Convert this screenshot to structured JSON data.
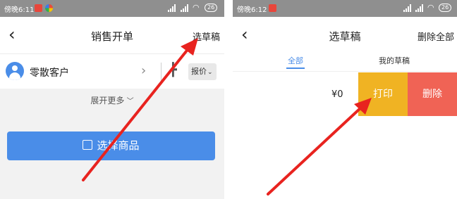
{
  "left": {
    "statusbar": {
      "time": "傍晚6:11",
      "battery": "26"
    },
    "navbar": {
      "title": "销售开单",
      "right": "选草稿"
    },
    "customer": {
      "name": "零散客户",
      "quote": "报价"
    },
    "expand": "展开更多",
    "select_goods": "选择商品"
  },
  "right": {
    "statusbar": {
      "time": "傍晚6:12",
      "battery": "26"
    },
    "navbar": {
      "title": "选草稿",
      "right": "删除全部"
    },
    "tabs": {
      "all": "全部",
      "mine": "我的草稿"
    },
    "draft": {
      "amount": "¥0",
      "print": "打印",
      "delete": "删除"
    }
  },
  "colors": {
    "accent": "#4a8de8",
    "print": "#f0b323",
    "delete": "#f06355",
    "annotation_arrow": "#e8231f",
    "statusbar": "#8f8f8f"
  },
  "icons": [
    "back-arrow-icon",
    "person-avatar-icon",
    "chevron-right-icon",
    "chevron-down-icon",
    "goods-icon",
    "wifi-icon",
    "signal-icon",
    "battery-icon"
  ]
}
